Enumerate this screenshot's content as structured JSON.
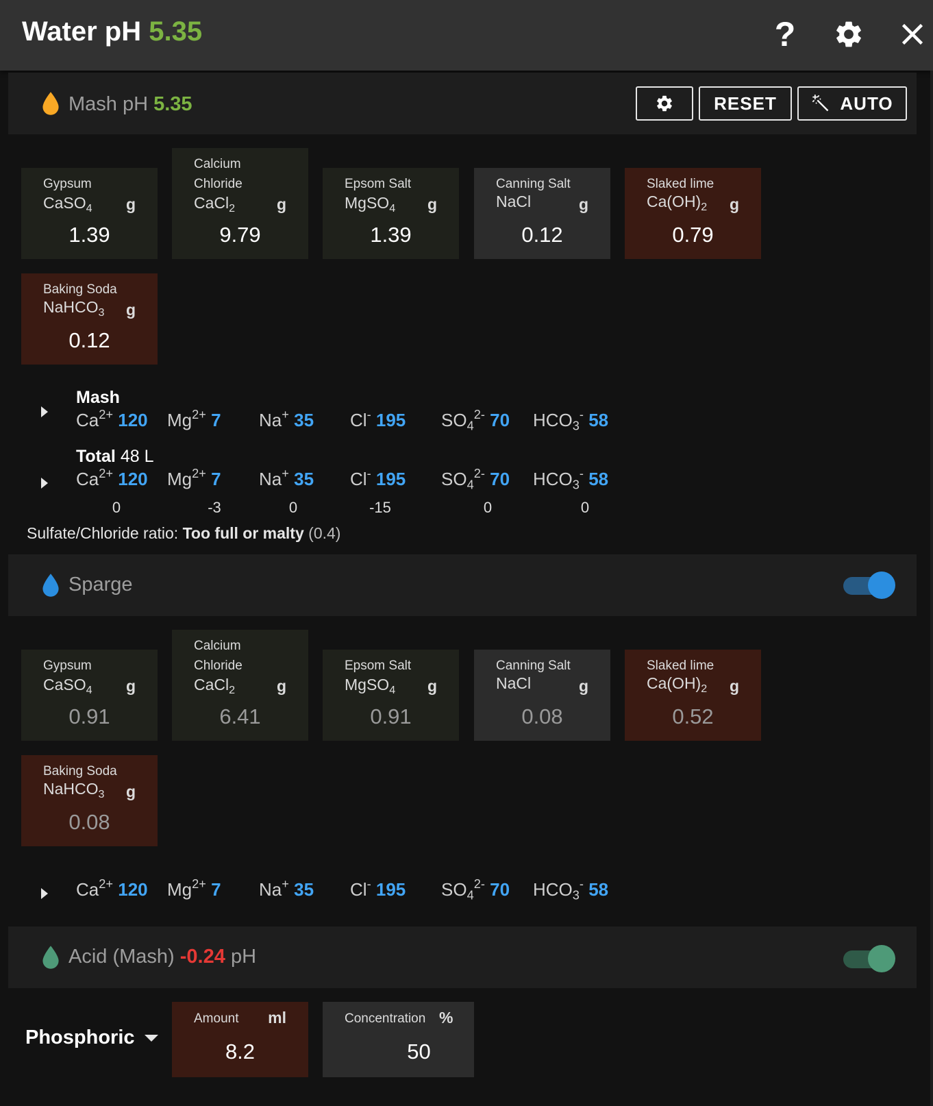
{
  "header": {
    "title": "Water pH",
    "ph": "5.35"
  },
  "mash": {
    "label": "Mash pH",
    "ph": "5.35",
    "reset_label": "RESET",
    "auto_label": "AUTO",
    "salts": [
      {
        "name_line1": "Gypsum",
        "name_line2": "",
        "formula": "CaSO",
        "sub": "4",
        "unit": "g",
        "value": "1.39"
      },
      {
        "name_line1": "Calcium",
        "name_line2": "Chloride",
        "formula": "CaCl",
        "sub": "2",
        "unit": "g",
        "value": "9.79"
      },
      {
        "name_line1": "Epsom Salt",
        "name_line2": "",
        "formula": "MgSO",
        "sub": "4",
        "unit": "g",
        "value": "1.39"
      },
      {
        "name_line1": "Canning Salt",
        "name_line2": "",
        "formula": "NaCl",
        "sub": "",
        "unit": "g",
        "value": "0.12"
      },
      {
        "name_line1": "Slaked lime",
        "name_line2": "",
        "formula": "Ca(OH)",
        "sub": "2",
        "unit": "g",
        "value": "0.79"
      },
      {
        "name_line1": "Baking Soda",
        "name_line2": "",
        "formula": "NaHCO",
        "sub": "3",
        "unit": "g",
        "value": "0.12"
      }
    ],
    "profile_label": "Mash",
    "ions": {
      "ca": "120",
      "mg": "7",
      "na": "35",
      "cl": "195",
      "so4": "70",
      "hco3": "58"
    },
    "total_label": "Total",
    "total_volume": "48 L",
    "total_ions": {
      "ca": "120",
      "mg": "7",
      "na": "35",
      "cl": "195",
      "so4": "70",
      "hco3": "58"
    },
    "deltas": {
      "ca": "0",
      "mg": "-3",
      "na": "0",
      "cl": "-15",
      "so4": "0",
      "hco3": "0"
    },
    "ratio_label": "Sulfate/Chloride ratio:",
    "ratio_desc": "Too full or malty",
    "ratio_value": "(0.4)"
  },
  "ion_labels": {
    "ca": "Ca",
    "ca_sup": "2+",
    "mg": "Mg",
    "mg_sup": "2+",
    "na": "Na",
    "na_sup": "+",
    "cl": "Cl",
    "cl_sup": "-",
    "so4": "SO",
    "so4_sub": "4",
    "so4_sup": "2-",
    "hco3": "HCO",
    "hco3_sub": "3",
    "hco3_sup": "-"
  },
  "sparge": {
    "label": "Sparge",
    "enabled": true,
    "salts": [
      {
        "name_line1": "Gypsum",
        "name_line2": "",
        "formula": "CaSO",
        "sub": "4",
        "unit": "g",
        "value": "0.91"
      },
      {
        "name_line1": "Calcium",
        "name_line2": "Chloride",
        "formula": "CaCl",
        "sub": "2",
        "unit": "g",
        "value": "6.41"
      },
      {
        "name_line1": "Epsom Salt",
        "name_line2": "",
        "formula": "MgSO",
        "sub": "4",
        "unit": "g",
        "value": "0.91"
      },
      {
        "name_line1": "Canning Salt",
        "name_line2": "",
        "formula": "NaCl",
        "sub": "",
        "unit": "g",
        "value": "0.08"
      },
      {
        "name_line1": "Slaked lime",
        "name_line2": "",
        "formula": "Ca(OH)",
        "sub": "2",
        "unit": "g",
        "value": "0.52"
      },
      {
        "name_line1": "Baking Soda",
        "name_line2": "",
        "formula": "NaHCO",
        "sub": "3",
        "unit": "g",
        "value": "0.08"
      }
    ],
    "ions": {
      "ca": "120",
      "mg": "7",
      "na": "35",
      "cl": "195",
      "so4": "70",
      "hco3": "58"
    }
  },
  "acid": {
    "label": "Acid (Mash)",
    "delta_ph": "-0.24",
    "ph_suffix": "pH",
    "enabled": true,
    "type": "Phosphoric",
    "amount_label": "Amount",
    "amount_unit": "ml",
    "amount_value": "8.2",
    "conc_label": "Concentration",
    "conc_unit": "%",
    "conc_value": "50"
  },
  "colors": {
    "accent_green": "#7cb342",
    "ion_blue": "#42a5f5",
    "acid_red": "#e53935",
    "drop_orange": "#f9a825",
    "drop_blue": "#2b8ee0",
    "drop_green": "#4e9a78"
  }
}
